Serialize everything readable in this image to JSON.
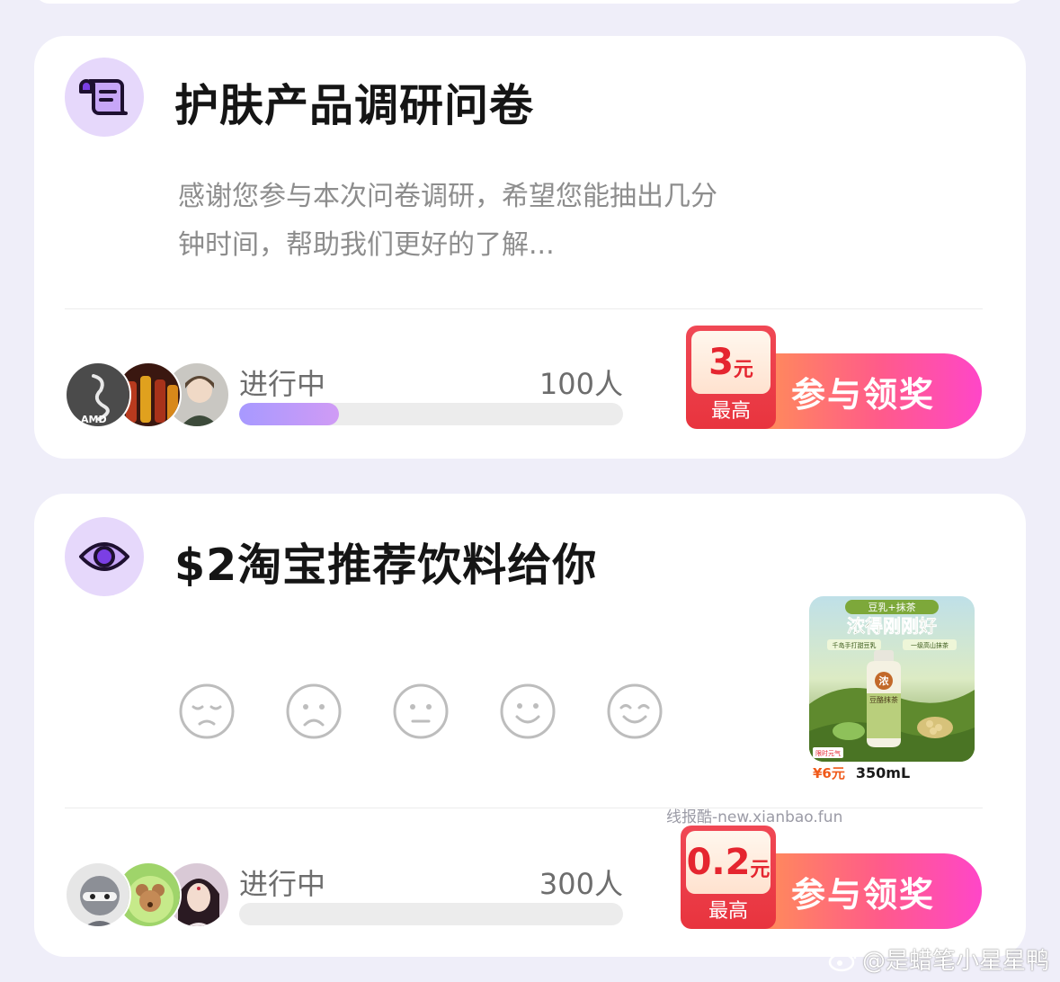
{
  "surveys": [
    {
      "icon": "scroll-icon",
      "title": "护肤产品调研问卷",
      "description": "感谢您参与本次问卷调研，希望您能抽出几分钟时间，帮助我们更好的了解...",
      "status": "进行中",
      "participants": "100人",
      "progress": 0.26,
      "reward": {
        "amount": "3",
        "unit": "元",
        "label": "最高"
      },
      "cta_label": "参与领奖",
      "avatars": [
        "amd-dragon-avatar",
        "bottles-avatar",
        "anime-character-avatar"
      ]
    },
    {
      "icon": "eye-icon",
      "title": "$2淘宝推荐饮料给你",
      "rating_options": [
        "very-unhappy-face-icon",
        "sad-face-icon",
        "neutral-face-icon",
        "smile-face-icon",
        "happy-face-icon"
      ],
      "product": {
        "image_texts": [
          "豆乳+抹茶",
          "浓得刚刚好",
          "千岛手打甜豆乳",
          "一级高山抹茶",
          "浓",
          "豆酪抹茶",
          "限时元气"
        ],
        "price": "¥6元",
        "volume": "350mL"
      },
      "status": "进行中",
      "participants": "300人",
      "progress": 0.0,
      "reward": {
        "amount": "0.2",
        "unit": "元",
        "label": "最高"
      },
      "cta_label": "参与领奖",
      "avatars": [
        "ninja-avatar",
        "cartoon-mouse-avatar",
        "girl-portrait-avatar"
      ]
    }
  ],
  "watermarks": {
    "site": "线报酷-new.xianbao.fun",
    "weibo": "@是蜡笔小星星鸭"
  },
  "colors": {
    "background": "#efeef9",
    "accent_purple": "#7b3fe4",
    "cta_gradient_start": "#ff9b4a",
    "cta_gradient_end": "#ff46c8",
    "reward_red": "#e8343e"
  }
}
